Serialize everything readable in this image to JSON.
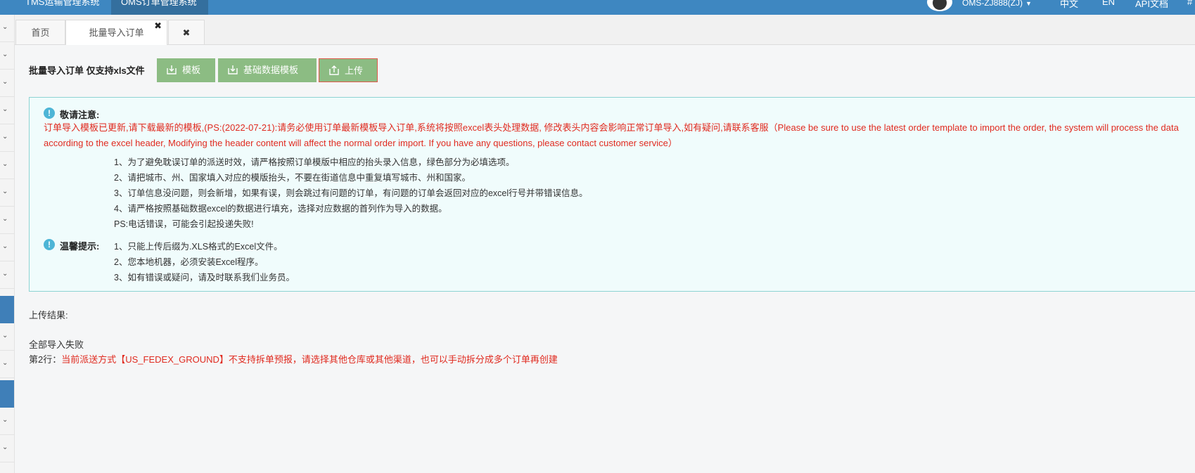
{
  "topbar": {
    "system_tab_1": "TMS运输管理系统",
    "system_tab_2": "OMS订单管理系统",
    "user": "OMS-ZJ888(ZJ)",
    "lang_cn": "中文",
    "lang_en": "EN",
    "api_docs": "API文档",
    "extra": "#"
  },
  "tabs": {
    "home": "首页",
    "batch_import": "批量导入订单"
  },
  "toolbar": {
    "title": "批量导入订单 仅支持xls文件",
    "template_button": "模板",
    "base_data_template_button": "基础数据模板",
    "upload_button": "上传"
  },
  "notice": {
    "heading": "敬请注意:",
    "red_text": "订单导入模板已更新,请下载最新的模板,(PS:(2022-07-21):请务必使用订单最新模板导入订单,系统将按照excel表头处理数据, 修改表头内容会影响正常订单导入,如有疑问,请联系客服（Please be sure to use the latest order template to import the order, the system will process the data according to the excel header, Modifying the header content will affect the normal order import. If you have any questions, please contact customer service）",
    "items": [
      "1、为了避免耽误订单的派送时效，请严格按照订单模版中相应的抬头录入信息，绿色部分为必填选项。",
      "2、请把城市、州、国家填入对应的模版抬头，不要在街道信息中重复填写城市、州和国家。",
      "3、订单信息没问题，则会新增，如果有误，则会跳过有问题的订单，有问题的订单会返回对应的excel行号并带错误信息。",
      "4、请严格按照基础数据excel的数据进行填充，选择对应数据的首列作为导入的数据。",
      "PS:电话错误，可能会引起投递失败!"
    ],
    "tips_heading": "温馨提示:",
    "tips": [
      "1、只能上传后缀为.XLS格式的Excel文件。",
      "2、您本地机器，必须安装Excel程序。",
      "3、如有错误或疑问，请及时联系我们业务员。"
    ]
  },
  "result": {
    "label": "上传结果:",
    "status": "全部导入失败",
    "row_prefix": "第2行：",
    "row_error": "当前派送方式【US_FEDEX_GROUND】不支持拆单预报，请选择其他仓库或其他渠道，也可以手动拆分成多个订单再创建"
  },
  "icons": {
    "download": "download-icon",
    "upload": "upload-icon",
    "warning": "exclamation-circle-icon",
    "close": "close-icon",
    "chevron": "chevron-down-icon"
  },
  "colors": {
    "topbar": "#3e87c1",
    "button_green": "#8cbc83",
    "error_red": "#e02a1f",
    "notice_bg": "#f0fcfc",
    "notice_border": "#8ed3d2"
  }
}
